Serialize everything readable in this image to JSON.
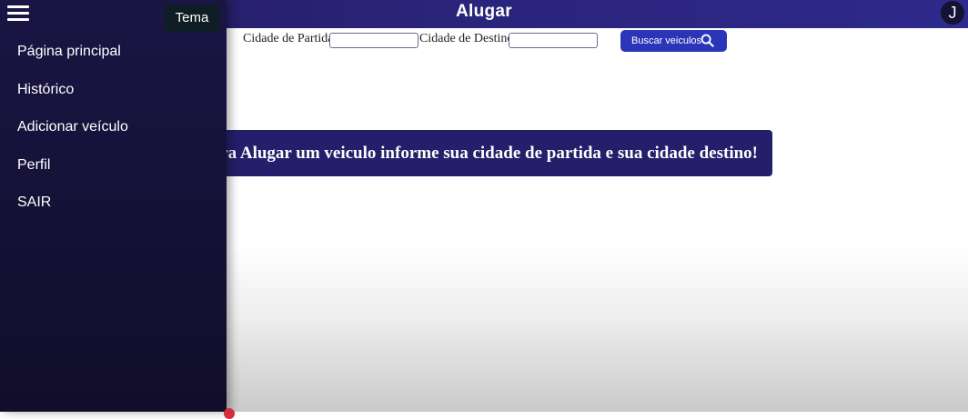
{
  "header": {
    "title": "Alugar",
    "avatar_letter": "J"
  },
  "search": {
    "origin_label": "Cidade de Partida",
    "origin_value": "",
    "destination_label": "Cidade de Destino",
    "destination_value": "",
    "button_label": "Buscar veiculos"
  },
  "banner": {
    "text": "Para Alugar um veiculo informe sua cidade de partida e sua cidade destino!"
  },
  "drawer": {
    "tema_label": "Tema",
    "items": [
      {
        "label": "Página principal"
      },
      {
        "label": "Histórico"
      },
      {
        "label": "Adicionar veículo"
      },
      {
        "label": "Perfil"
      },
      {
        "label": "SAIR"
      }
    ]
  },
  "colors": {
    "header_bg": "#2a2378",
    "drawer_bg": "#16123a",
    "button_bg": "#2b35b8",
    "banner_bg": "#241f6a"
  },
  "icons": [
    "menu-icon",
    "search-icon"
  ]
}
